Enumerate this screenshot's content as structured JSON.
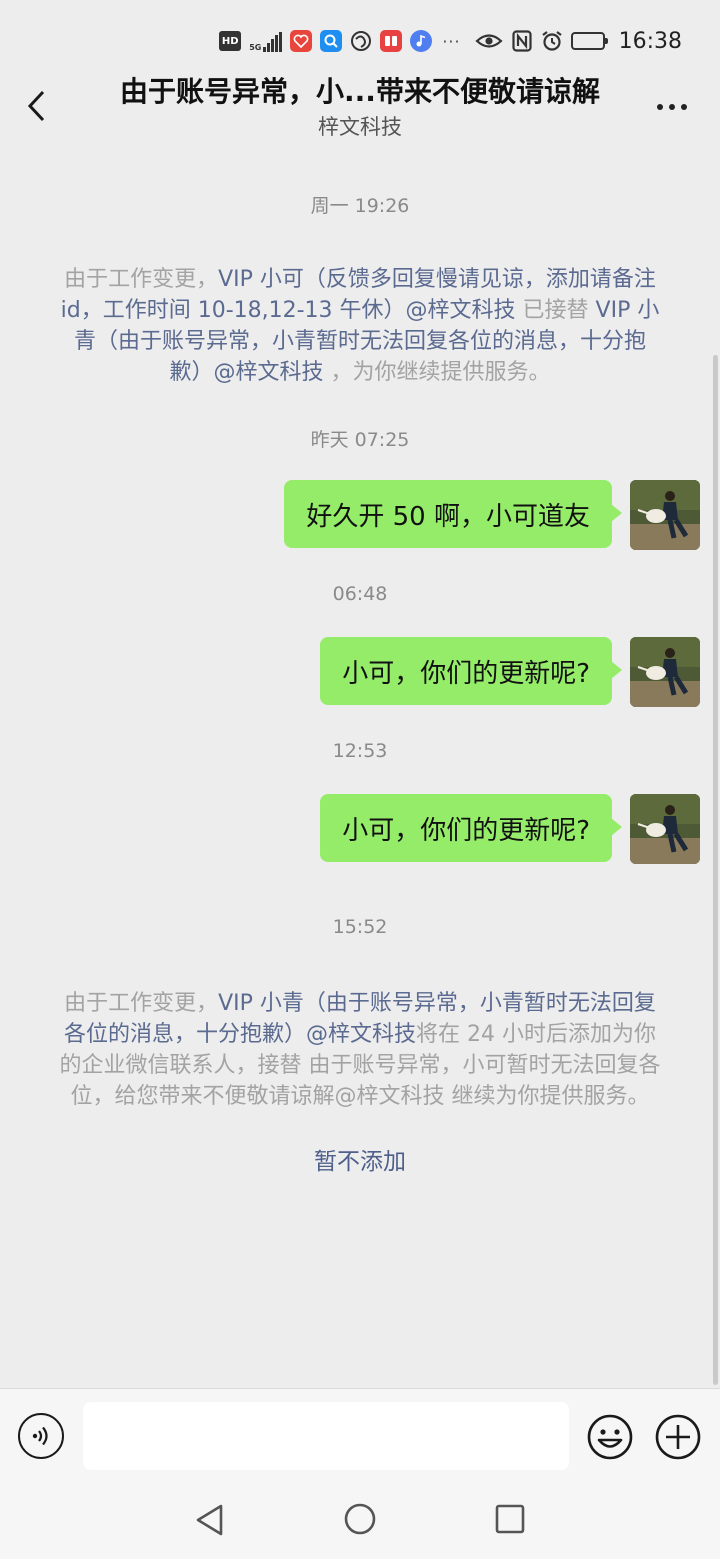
{
  "status_bar": {
    "hd_label": "HD",
    "signal_label": "5G",
    "more_dots": "···",
    "time": "16:38",
    "battery_level": 0.72
  },
  "header": {
    "title": "由于账号异常，小...带来不便敬请谅解",
    "subtitle": "梓文科技"
  },
  "messages": {
    "ts1": "周一 19:26",
    "notice1": {
      "part1": "由于工作变更，",
      "link1": "VIP 小可（反馈多回复慢请见谅，添加请备注 id，工作时间 10-18,12-13 午休）@梓文科技",
      "part2": " 已接替 ",
      "link2": "VIP 小青（由于账号异常，小青暂时无法回复各位的消息，十分抱歉）@梓文科技",
      "part3": " ，为你继续提供服务。"
    },
    "ts2": "昨天 07:25",
    "msg1": "好久开 50 啊，小可道友",
    "ts3": "06:48",
    "msg2": "小可，你们的更新呢?",
    "ts4": "12:53",
    "msg3": "小可，你们的更新呢?",
    "ts5": "15:52",
    "notice2": {
      "part1": "由于工作变更，",
      "link1": "VIP 小青（由于账号异常，小青暂时无法回复各位的消息，十分抱歉）@梓文科技",
      "part2": "将在 24 小时后添加为你的企业微信联系人，接替 由于账号异常，小可暂时无法回复各位，给您带来不便敬请谅解@梓文科技 继续为你提供服务。"
    },
    "decline_action": "暂不添加"
  },
  "input_bar": {
    "value": "",
    "placeholder": ""
  },
  "icons": {
    "back": "chevron-left-icon",
    "more": "more-dots-icon",
    "voice": "voice-icon",
    "emoji": "emoji-icon",
    "plus": "plus-icon",
    "nav_back": "triangle-back-icon",
    "nav_home": "circle-home-icon",
    "nav_recent": "square-recent-icon"
  },
  "colors": {
    "background": "#ededed",
    "bubble_green": "#95ec69",
    "link_blue": "#5b6a90",
    "notice_gray": "#a3a3a3"
  }
}
